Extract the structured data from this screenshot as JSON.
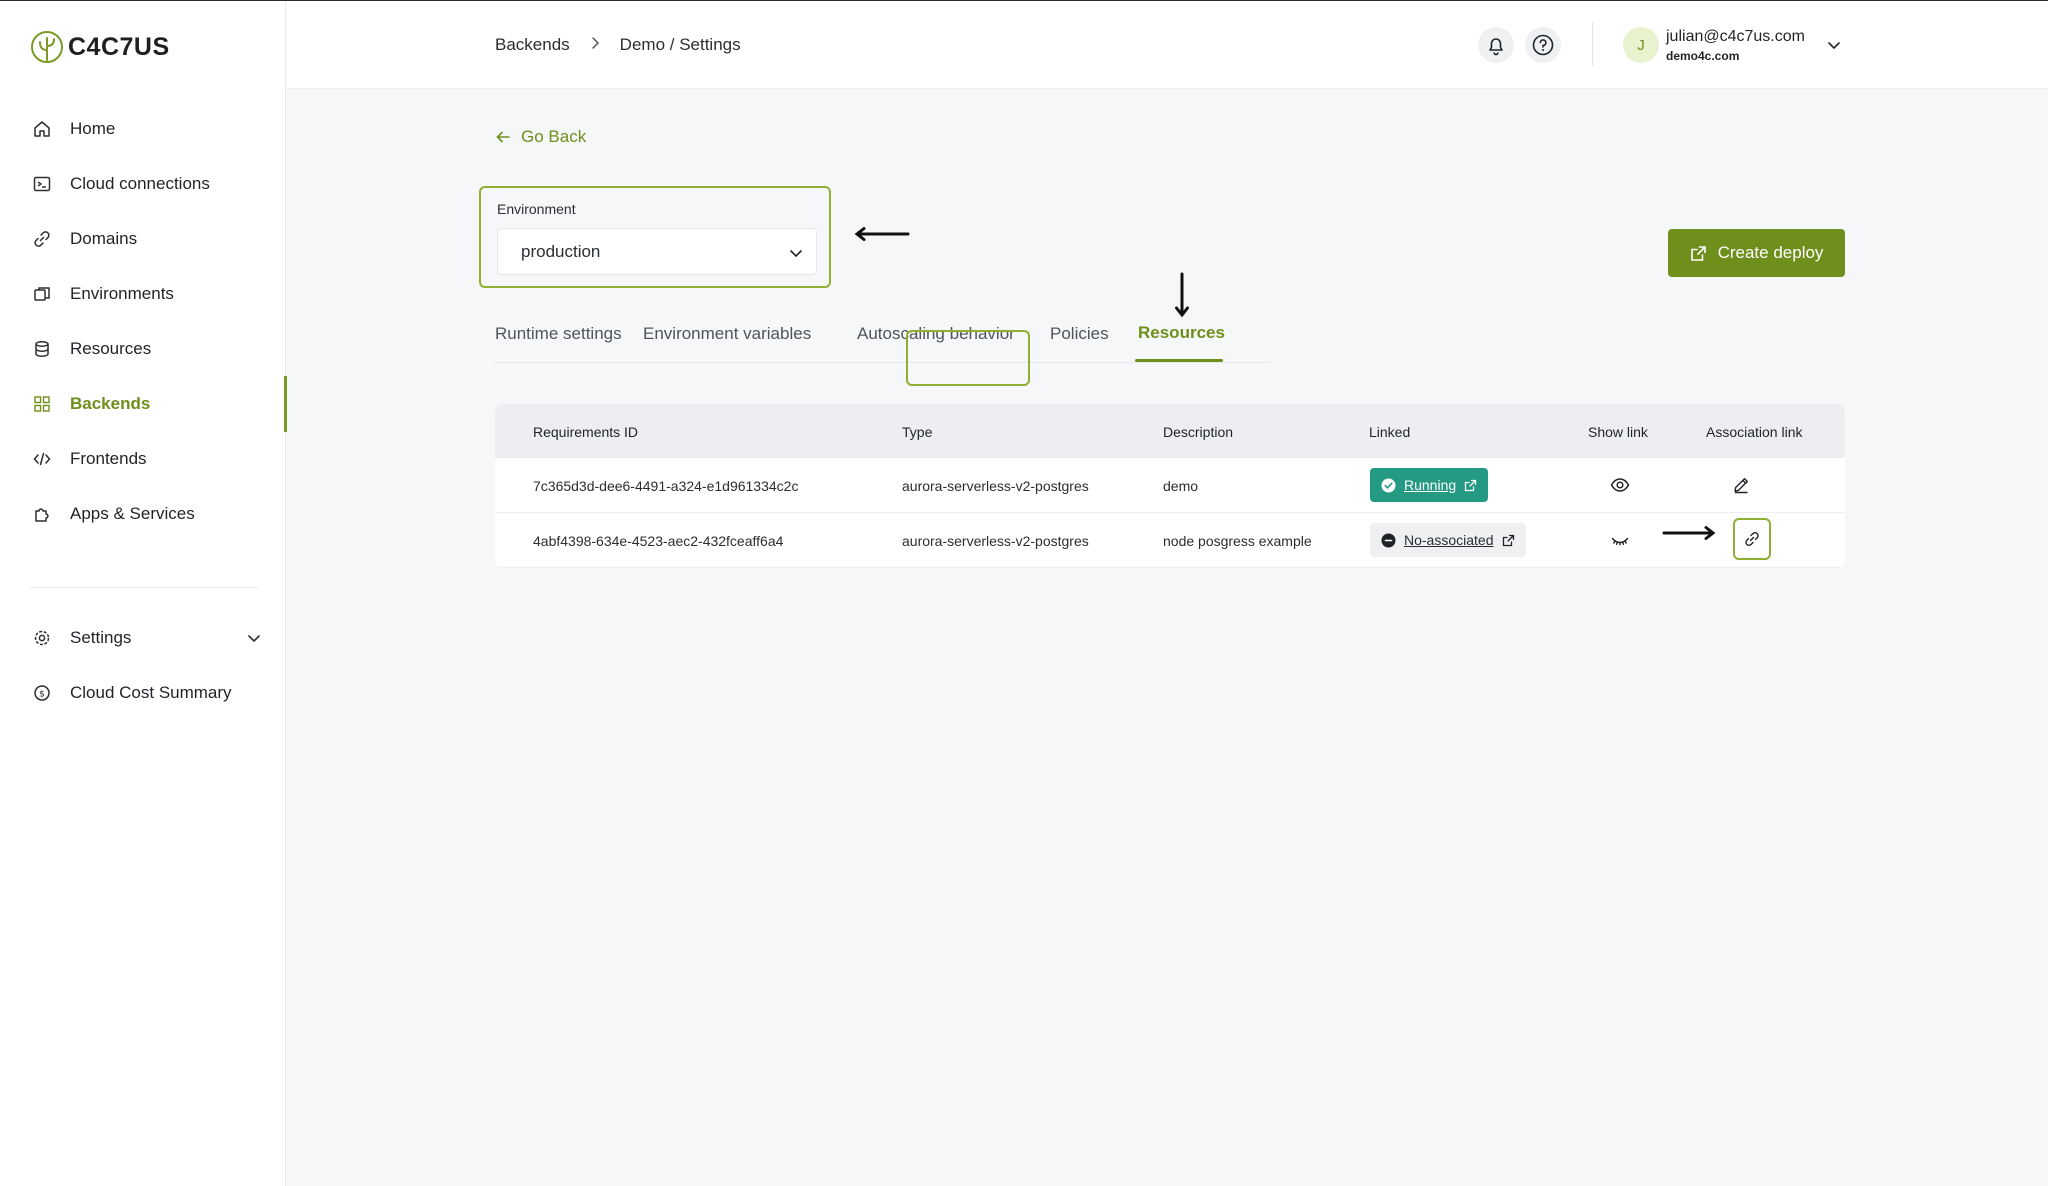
{
  "brand": {
    "name": "C4C7US",
    "accent": "#6f8f1c",
    "highlight": "#8fae32"
  },
  "sidebar": {
    "items": [
      {
        "label": "Home",
        "icon": "home-icon"
      },
      {
        "label": "Cloud connections",
        "icon": "terminal-icon"
      },
      {
        "label": "Domains",
        "icon": "link-icon"
      },
      {
        "label": "Environments",
        "icon": "environments-icon"
      },
      {
        "label": "Resources",
        "icon": "database-icon"
      },
      {
        "label": "Backends",
        "icon": "grid-icon",
        "active": true
      },
      {
        "label": "Frontends",
        "icon": "code-icon"
      },
      {
        "label": "Apps & Services",
        "icon": "puzzle-icon"
      }
    ],
    "bottom": [
      {
        "label": "Settings",
        "icon": "gear-icon"
      },
      {
        "label": "Cloud Cost Summary",
        "icon": "dollar-icon"
      }
    ]
  },
  "header": {
    "breadcrumb": [
      "Backends",
      "Demo / Settings"
    ],
    "user": {
      "initial": "J",
      "email": "julian@c4c7us.com",
      "org": "demo4c.com"
    }
  },
  "main": {
    "go_back": "Go Back",
    "environment": {
      "label": "Environment",
      "value": "production"
    },
    "create_deploy": "Create deploy",
    "tabs": [
      "Runtime settings",
      "Environment variables",
      "Autoscaling behavior",
      "Policies",
      "Resources"
    ],
    "active_tab": "Resources",
    "table": {
      "headers": [
        "Requirements ID",
        "Type",
        "Description",
        "Linked",
        "Show link",
        "Association link"
      ],
      "rows": [
        {
          "id": "7c365d3d-dee6-4491-a324-e1d961334c2c",
          "type": "aurora-serverless-v2-postgres",
          "description": "demo",
          "linked": "Running",
          "show_link_icon": "eye-icon",
          "association_icon": "edit-icon"
        },
        {
          "id": "4abf4398-634e-4523-aec2-432fceaff6a4",
          "type": "aurora-serverless-v2-postgres",
          "description": "node posgress example",
          "linked": "No-associated",
          "show_link_icon": "eye-closed-icon",
          "association_icon": "link-icon"
        }
      ]
    }
  }
}
